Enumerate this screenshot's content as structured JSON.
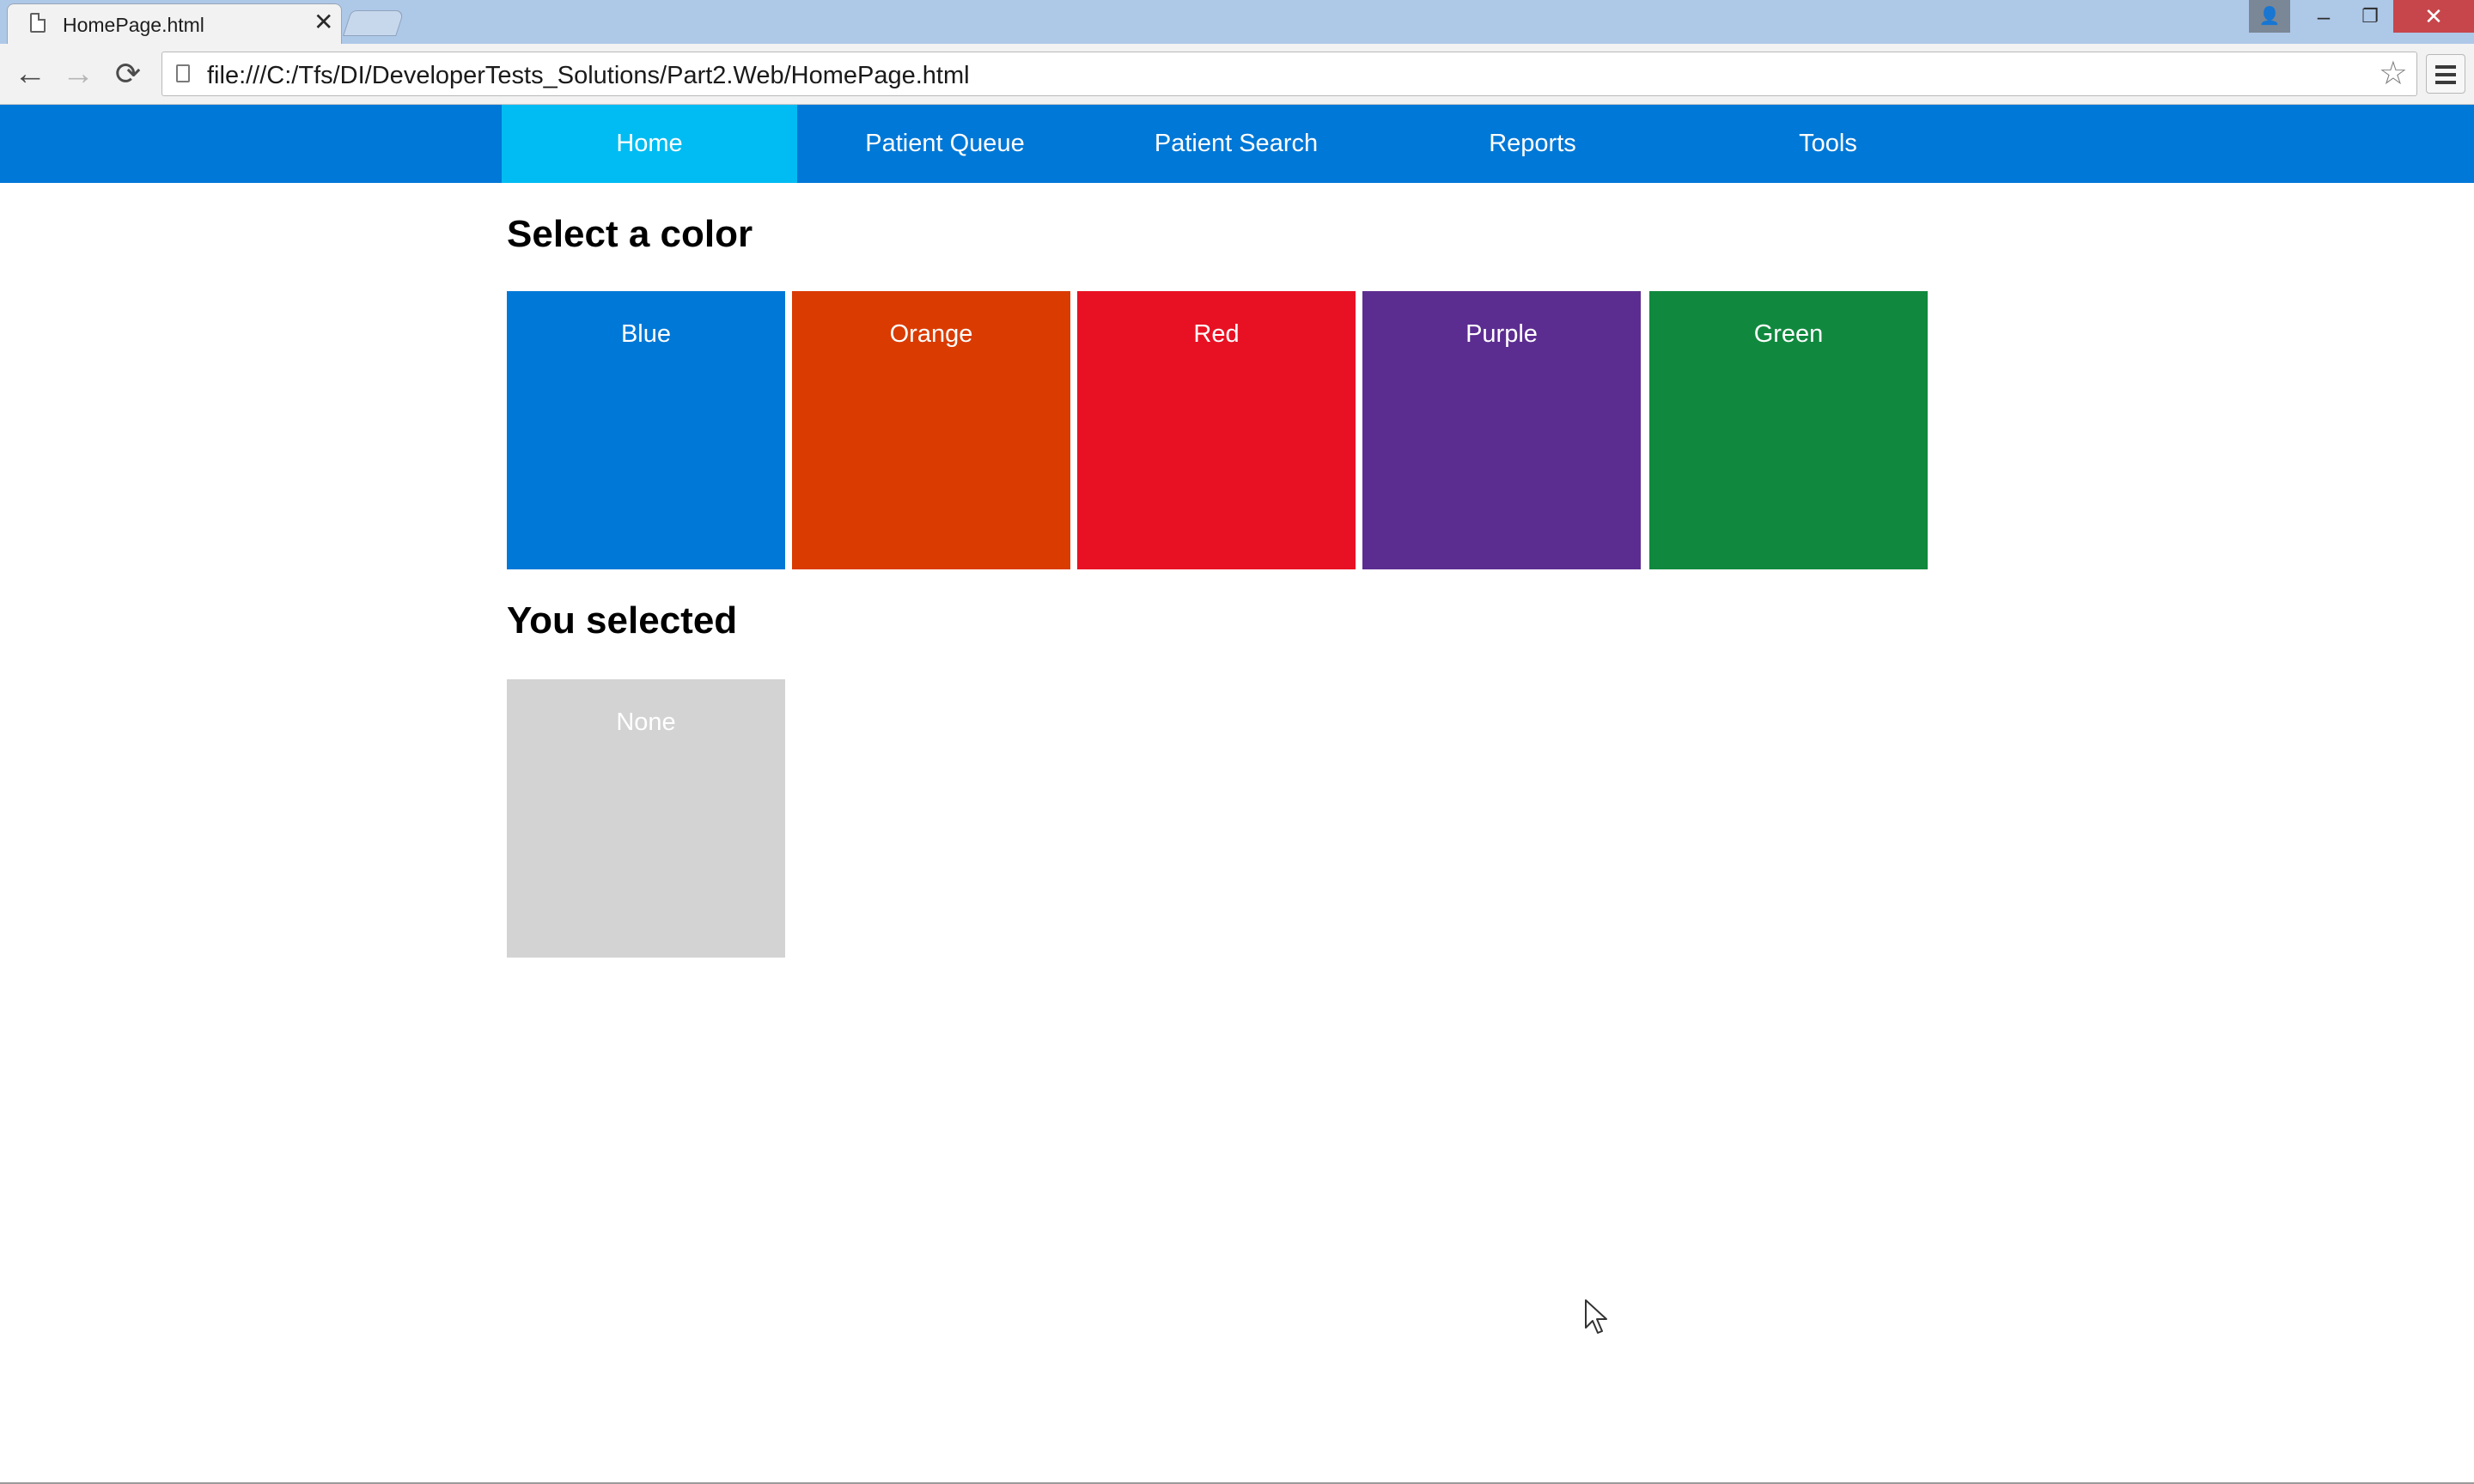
{
  "browser": {
    "tab": {
      "title": "HomePage.html",
      "close_glyph": "✕"
    },
    "address_bar": {
      "url": "file:///C:/Tfs/DI/DeveloperTests_Solutions/Part2.Web/HomePage.html"
    },
    "icons": {
      "back": "back-arrow-icon",
      "forward": "forward-arrow-icon",
      "reload": "reload-icon",
      "bookmark": "star-icon",
      "menu": "hamburger-menu-icon",
      "profile": "person-icon"
    },
    "window_controls": {
      "minimize": "–",
      "restore": "❐",
      "close": "✕",
      "profile": "👤"
    },
    "glyphs": {
      "back": "←",
      "forward": "→",
      "reload": "⟳",
      "star": "☆"
    }
  },
  "nav": {
    "items": [
      {
        "label": "Home",
        "active": true
      },
      {
        "label": "Patient Queue",
        "active": false
      },
      {
        "label": "Patient Search",
        "active": false
      },
      {
        "label": "Reports",
        "active": false
      },
      {
        "label": "Tools",
        "active": false
      }
    ],
    "colors": {
      "bar": "#0078d7",
      "active": "#00bcf2"
    }
  },
  "main": {
    "select_heading": "Select a color",
    "colors": [
      {
        "label": "Blue",
        "hex": "#0078d7"
      },
      {
        "label": "Orange",
        "hex": "#da3b01"
      },
      {
        "label": "Red",
        "hex": "#e81123"
      },
      {
        "label": "Purple",
        "hex": "#5c2d91"
      },
      {
        "label": "Green",
        "hex": "#10893e"
      }
    ],
    "selected_heading": "You selected",
    "selected": {
      "label": "None",
      "hex": "#d3d3d3"
    }
  }
}
